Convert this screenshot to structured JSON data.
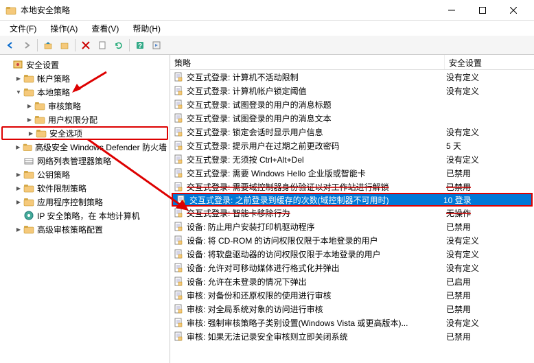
{
  "window": {
    "title": "本地安全策略"
  },
  "menu": {
    "file": "文件(F)",
    "action": "操作(A)",
    "view": "查看(V)",
    "help": "帮助(H)"
  },
  "tree": {
    "root": "安全设置",
    "items": [
      {
        "label": "帐户策略",
        "expand": "right",
        "indent": 1,
        "icon": "folder"
      },
      {
        "label": "本地策略",
        "expand": "down",
        "indent": 1,
        "icon": "folder"
      },
      {
        "label": "审核策略",
        "expand": "right",
        "indent": 2,
        "icon": "folder"
      },
      {
        "label": "用户权限分配",
        "expand": "right",
        "indent": 2,
        "icon": "folder"
      },
      {
        "label": "安全选项",
        "expand": "right",
        "indent": 2,
        "icon": "folder",
        "highlight": true
      },
      {
        "label": "高级安全 Windows Defender 防火墙",
        "expand": "right",
        "indent": 1,
        "icon": "folder"
      },
      {
        "label": "网络列表管理器策略",
        "expand": "",
        "indent": 1,
        "icon": "folder-net"
      },
      {
        "label": "公钥策略",
        "expand": "right",
        "indent": 1,
        "icon": "folder"
      },
      {
        "label": "软件限制策略",
        "expand": "right",
        "indent": 1,
        "icon": "folder"
      },
      {
        "label": "应用程序控制策略",
        "expand": "right",
        "indent": 1,
        "icon": "folder"
      },
      {
        "label": "IP 安全策略，在 本地计算机",
        "expand": "",
        "indent": 1,
        "icon": "ip"
      },
      {
        "label": "高级审核策略配置",
        "expand": "right",
        "indent": 1,
        "icon": "folder"
      }
    ]
  },
  "list": {
    "header_policy": "策略",
    "header_setting": "安全设置",
    "rows": [
      {
        "label": "交互式登录: 计算机不活动限制",
        "setting": "没有定义"
      },
      {
        "label": "交互式登录: 计算机帐户锁定阈值",
        "setting": "没有定义"
      },
      {
        "label": "交互式登录: 试图登录的用户的消息标题",
        "setting": ""
      },
      {
        "label": "交互式登录: 试图登录的用户的消息文本",
        "setting": ""
      },
      {
        "label": "交互式登录: 锁定会话时显示用户信息",
        "setting": "没有定义"
      },
      {
        "label": "交互式登录: 提示用户在过期之前更改密码",
        "setting": "5 天"
      },
      {
        "label": "交互式登录: 无须按 Ctrl+Alt+Del",
        "setting": "没有定义"
      },
      {
        "label": "交互式登录: 需要 Windows Hello 企业版或智能卡",
        "setting": "已禁用"
      },
      {
        "label": "交互式登录: 需要域控制器身份验证以对工作站进行解锁",
        "setting": "已禁用",
        "struck": true
      },
      {
        "label": "交互式登录: 之前登录到缓存的次数(域控制器不可用时)",
        "setting": "10 登录",
        "selected": true
      },
      {
        "label": "交互式登录: 智能卡移除行为",
        "setting": "无操作",
        "struck": true
      },
      {
        "label": "设备: 防止用户安装打印机驱动程序",
        "setting": "已禁用"
      },
      {
        "label": "设备: 将 CD-ROM 的访问权限仅限于本地登录的用户",
        "setting": "没有定义"
      },
      {
        "label": "设备: 将软盘驱动器的访问权限仅限于本地登录的用户",
        "setting": "没有定义"
      },
      {
        "label": "设备: 允许对可移动媒体进行格式化并弹出",
        "setting": "没有定义"
      },
      {
        "label": "设备: 允许在未登录的情况下弹出",
        "setting": "已启用"
      },
      {
        "label": "审核: 对备份和还原权限的使用进行审核",
        "setting": "已禁用"
      },
      {
        "label": "审核: 对全局系统对象的访问进行审核",
        "setting": "已禁用"
      },
      {
        "label": "审核: 强制审核策略子类别设置(Windows Vista 或更高版本)...",
        "setting": "没有定义"
      },
      {
        "label": "审核: 如果无法记录安全审核则立即关闭系统",
        "setting": "已禁用"
      }
    ]
  }
}
